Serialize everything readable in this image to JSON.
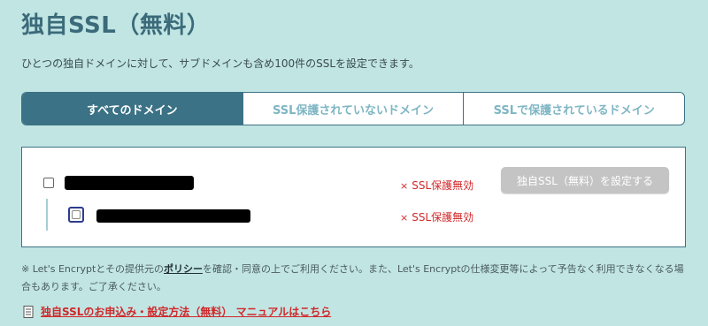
{
  "page": {
    "title": "独自SSL（無料）",
    "description": "ひとつの独自ドメインに対して、サブドメインも含め100件のSSLを設定できます。"
  },
  "tabs": [
    {
      "label": "すべてのドメイン",
      "active": true
    },
    {
      "label": "SSL保護されていないドメイン",
      "active": false
    },
    {
      "label": "SSLで保護されているドメイン",
      "active": false
    }
  ],
  "domains": [
    {
      "status": "SSL保護無効",
      "status_mark": "×",
      "button": "独自SSL（無料）を設定する"
    },
    {
      "status": "SSL保護無効",
      "status_mark": "×"
    }
  ],
  "note": {
    "prefix": "※ Let's Encryptとその提供元の",
    "policy_link": "ポリシー",
    "suffix": "を確認・同意の上でご利用ください。また、Let's Encryptの仕様変更等によって予告なく利用できなくなる場合もあります。ご了承ください。"
  },
  "manual": {
    "icon": "document-icon",
    "link_text": "独自SSLのお申込み・設定方法（無料） マニュアルはこちら"
  },
  "colors": {
    "background": "#c1e5e3",
    "accent": "#3b7285",
    "status_red": "#d0282a",
    "disabled_button": "#c4c4c4"
  }
}
